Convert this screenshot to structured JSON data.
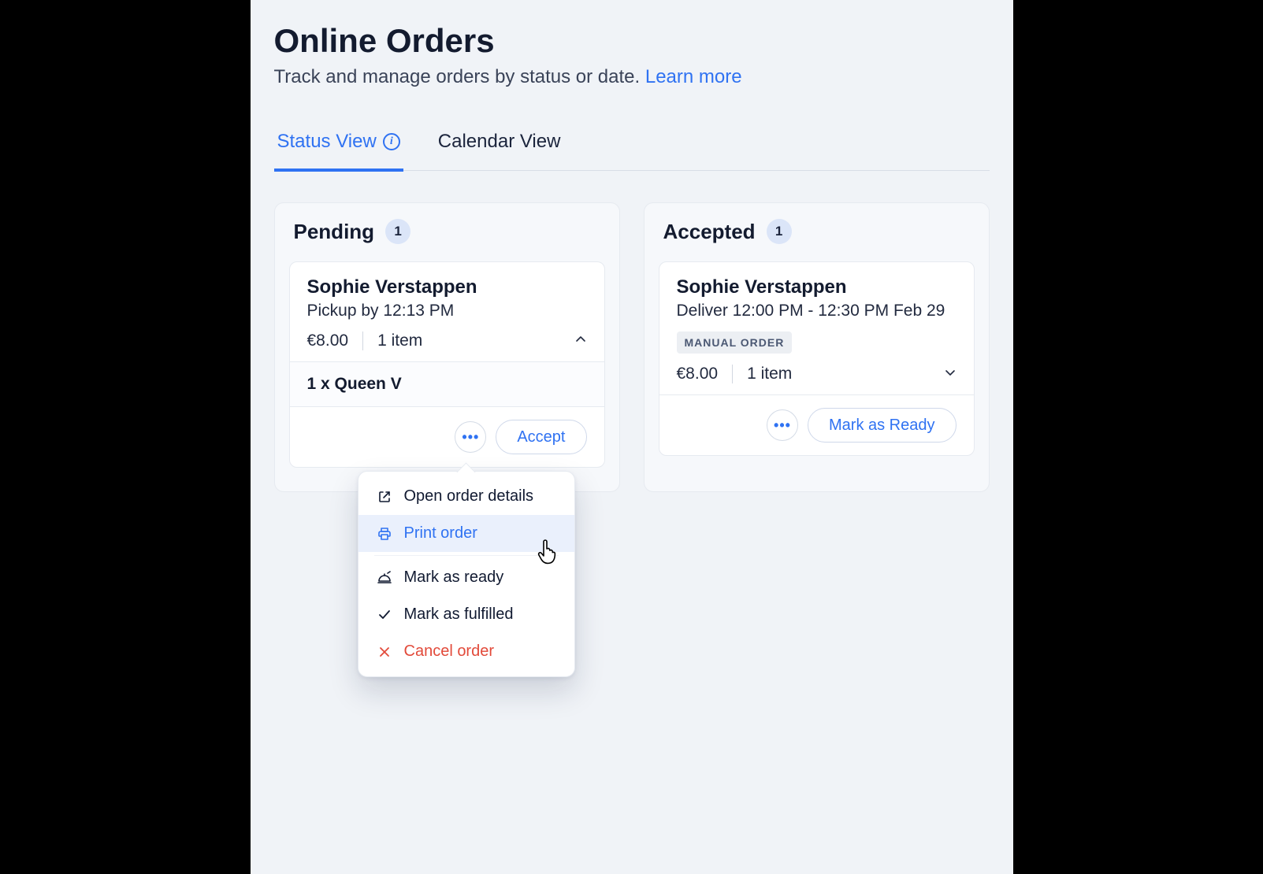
{
  "header": {
    "title": "Online Orders",
    "subtitle_prefix": "Track and manage orders by status or date. ",
    "learn_more": "Learn more"
  },
  "tabs": {
    "status": "Status View",
    "calendar": "Calendar View"
  },
  "columns": {
    "pending": {
      "title": "Pending",
      "count": "1",
      "card": {
        "customer": "Sophie Verstappen",
        "fulfil": "Pickup by 12:13 PM",
        "price": "€8.00",
        "items": "1 item",
        "line_item": "1 x Queen V",
        "action_btn": "Accept"
      }
    },
    "accepted": {
      "title": "Accepted",
      "count": "1",
      "card": {
        "customer": "Sophie Verstappen",
        "fulfil": "Deliver 12:00 PM - 12:30 PM Feb 29",
        "manual_tag": "MANUAL ORDER",
        "price": "€8.00",
        "items": "1 item",
        "action_btn": "Mark as Ready"
      }
    }
  },
  "dropdown": {
    "open_details": "Open order details",
    "print": "Print order",
    "mark_ready": "Mark as ready",
    "mark_fulfilled": "Mark as fulfilled",
    "cancel": "Cancel order"
  }
}
